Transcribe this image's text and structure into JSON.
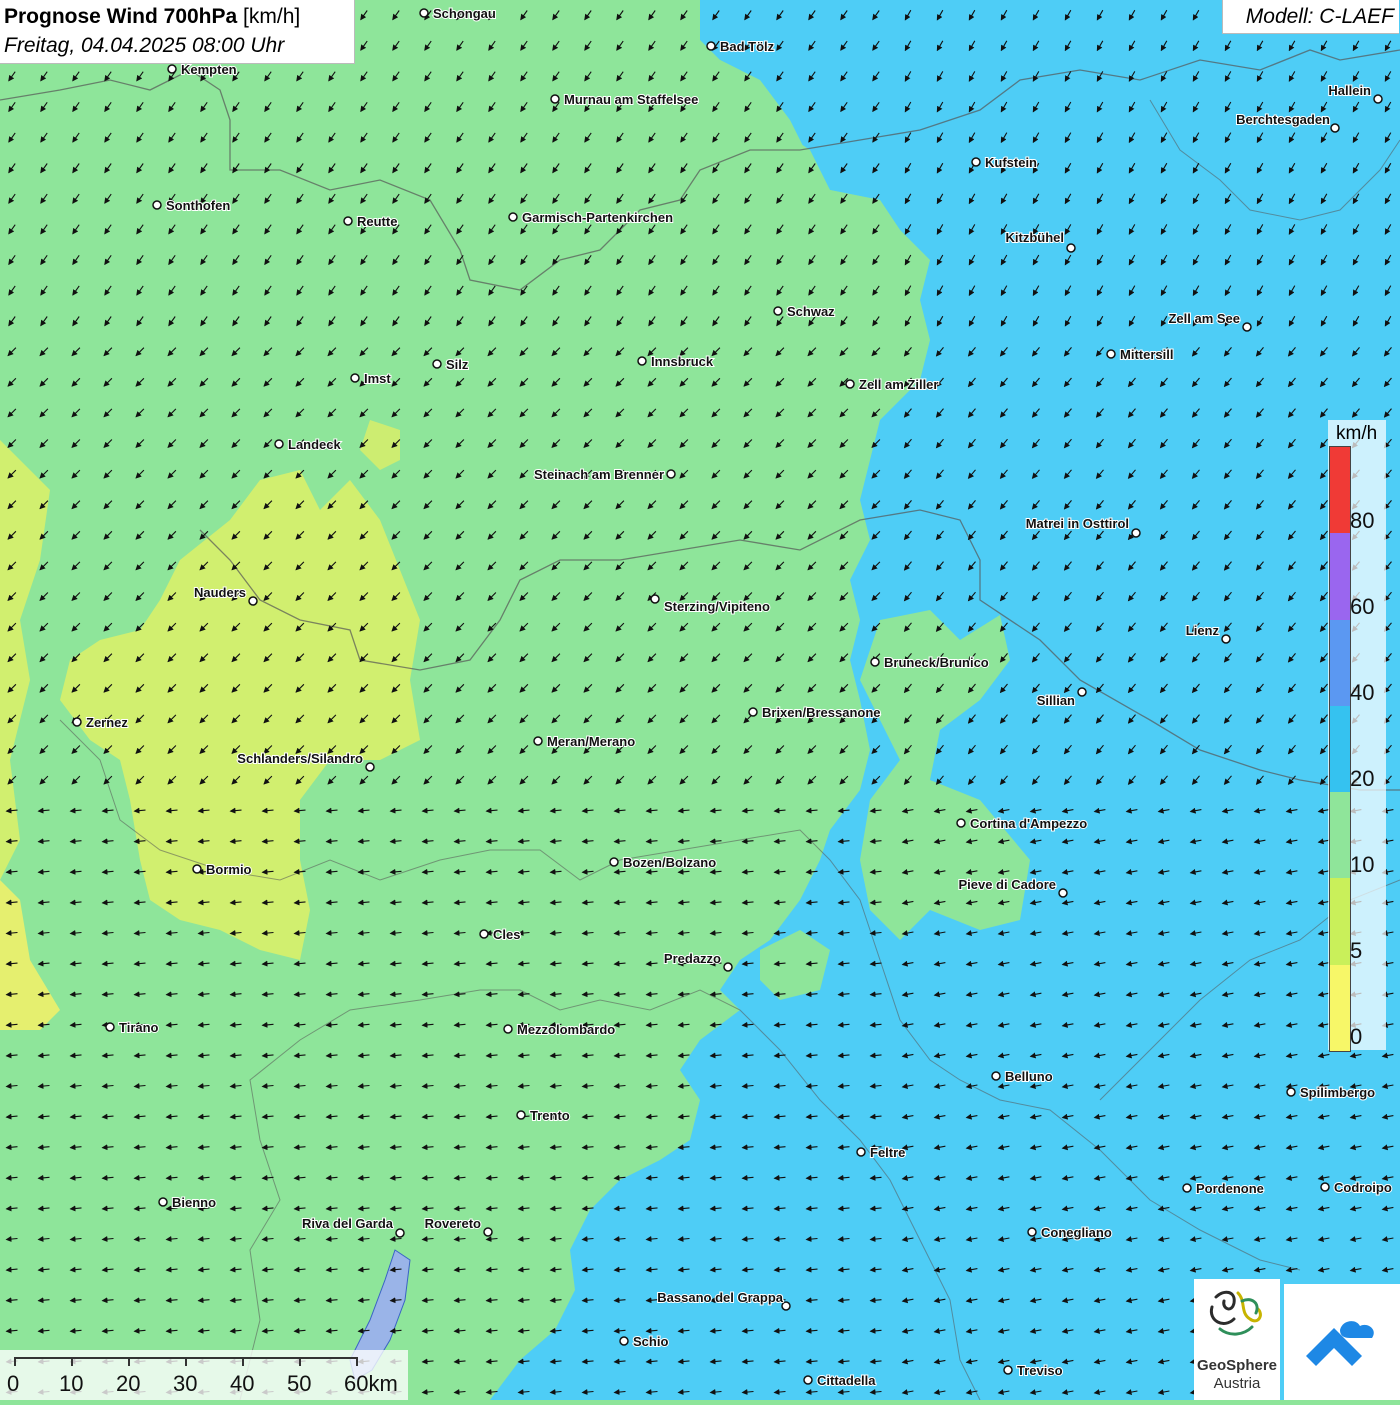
{
  "header": {
    "title_bold": "Prognose Wind 700hPa",
    "title_unit": " [km/h]",
    "subtitle": "Freitag, 04.04.2025 08:00 Uhr",
    "model": "Modell: C-LAEF"
  },
  "legend": {
    "unit": "km/h",
    "classes": [
      {
        "label": "0",
        "color": "#f7f768"
      },
      {
        "label": "5",
        "color": "#c9f05a"
      },
      {
        "label": "10",
        "color": "#8fe59a"
      },
      {
        "label": "20",
        "color": "#35c2f0"
      },
      {
        "label": "40",
        "color": "#5b98f2"
      },
      {
        "label": "60",
        "color": "#9a66ef"
      },
      {
        "label": "80",
        "color": "#f03a36"
      }
    ]
  },
  "scale_bar": {
    "labels": [
      "0",
      "10",
      "20",
      "30",
      "40",
      "50",
      "60km"
    ]
  },
  "logo": {
    "line1": "GeoSphere",
    "line2": "Austria"
  },
  "cities": [
    {
      "name": "Schongau"
    },
    {
      "name": "Bad Tölz"
    },
    {
      "name": "Kempten"
    },
    {
      "name": "Murnau am Staffelsee"
    },
    {
      "name": "Hallein"
    },
    {
      "name": "Berchtesgaden"
    },
    {
      "name": "Kufstein"
    },
    {
      "name": "Sonthofen"
    },
    {
      "name": "Reutte"
    },
    {
      "name": "Garmisch-Partenkirchen"
    },
    {
      "name": "Kitzbühel"
    },
    {
      "name": "Schwaz"
    },
    {
      "name": "Zell am See"
    },
    {
      "name": "Mittersill"
    },
    {
      "name": "Imst"
    },
    {
      "name": "Silz"
    },
    {
      "name": "Innsbruck"
    },
    {
      "name": "Zell am Ziller"
    },
    {
      "name": "Landeck"
    },
    {
      "name": "Steinach am Brenner"
    },
    {
      "name": "Matrei in Osttirol"
    },
    {
      "name": "Nauders"
    },
    {
      "name": "Sterzing/Vipiteno"
    },
    {
      "name": "Lienz"
    },
    {
      "name": "Bruneck/Brunico"
    },
    {
      "name": "Sillian"
    },
    {
      "name": "Zernez"
    },
    {
      "name": "Brixen/Bressanone"
    },
    {
      "name": "Meran/Merano"
    },
    {
      "name": "Schlanders/Silandro"
    },
    {
      "name": "Cortina d'Ampezzo"
    },
    {
      "name": "Bozen/Bolzano"
    },
    {
      "name": "Bormio"
    },
    {
      "name": "Pieve di Cadore"
    },
    {
      "name": "Cles"
    },
    {
      "name": "Predazzo"
    },
    {
      "name": "Tirano"
    },
    {
      "name": "Mezzolombardo"
    },
    {
      "name": "Belluno"
    },
    {
      "name": "Spilimbergo"
    },
    {
      "name": "Trento"
    },
    {
      "name": "Feltre"
    },
    {
      "name": "Pordenone"
    },
    {
      "name": "Codroipo"
    },
    {
      "name": "Bienno"
    },
    {
      "name": "Riva del Garda"
    },
    {
      "name": "Rovereto"
    },
    {
      "name": "Conegliano"
    },
    {
      "name": "Bassano del Grappa"
    },
    {
      "name": "Schio"
    },
    {
      "name": "Treviso"
    },
    {
      "name": "Cittadella"
    }
  ]
}
